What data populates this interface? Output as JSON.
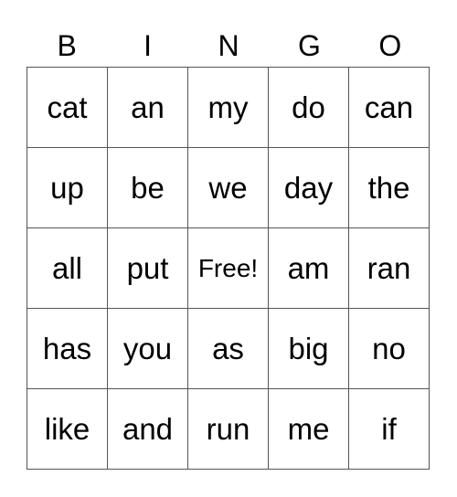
{
  "header": [
    "B",
    "I",
    "N",
    "G",
    "O"
  ],
  "rows": [
    [
      "cat",
      "an",
      "my",
      "do",
      "can"
    ],
    [
      "up",
      "be",
      "we",
      "day",
      "the"
    ],
    [
      "all",
      "put",
      "Free!",
      "am",
      "ran"
    ],
    [
      "has",
      "you",
      "as",
      "big",
      "no"
    ],
    [
      "like",
      "and",
      "run",
      "me",
      "if"
    ]
  ]
}
